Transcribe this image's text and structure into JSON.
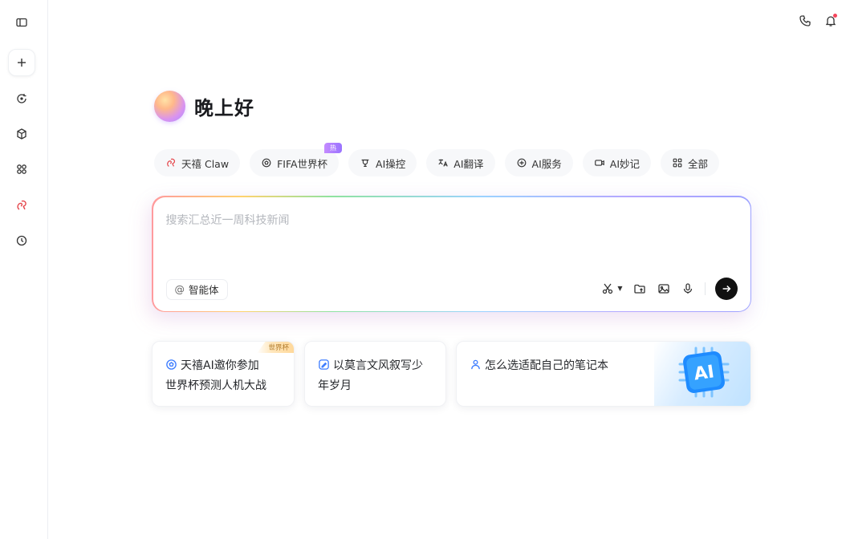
{
  "sidebar": {
    "items": [
      {
        "icon": "sidebar-toggle-icon"
      },
      {
        "icon": "plus-icon"
      },
      {
        "icon": "chat-refresh-icon"
      },
      {
        "icon": "cube-icon"
      },
      {
        "icon": "apps-icon"
      },
      {
        "icon": "claw-icon",
        "color": "#e5484d"
      },
      {
        "icon": "history-icon"
      }
    ]
  },
  "topbar": {
    "icons": [
      "phone-icon",
      "bell-icon"
    ],
    "notification_dot_color": "#f5455c"
  },
  "greeting": "晚上好",
  "chips": [
    {
      "label": "天禧 Claw",
      "icon": "claw-icon",
      "icon_color": "#e5484d"
    },
    {
      "label": "FIFA世界杯",
      "icon": "soccer-icon",
      "badge": "热"
    },
    {
      "label": "AI操控",
      "icon": "steering-icon"
    },
    {
      "label": "AI翻译",
      "icon": "translate-icon"
    },
    {
      "label": "AI服务",
      "icon": "service-icon"
    },
    {
      "label": "AI妙记",
      "icon": "record-icon"
    },
    {
      "label": "全部",
      "icon": "grid-icon"
    }
  ],
  "input": {
    "placeholder": "搜索汇总近一周科技新闻",
    "agent_label": "智能体",
    "tools": [
      "scissors-icon",
      "folder-upload-icon",
      "image-icon",
      "mic-icon"
    ],
    "send_icon": "arrow-right-icon"
  },
  "suggestions": [
    {
      "line1": "天禧AI邀你参加",
      "line2": "世界杯预测人机大战",
      "tag": "世界杯",
      "icon": "soccer-icon"
    },
    {
      "line1": "以莫言文风叙写少",
      "line2": "年岁月",
      "icon": "pen-icon"
    },
    {
      "line1": "怎么选适配自己的笔记本",
      "line2": "",
      "icon": "person-icon",
      "art": "AI"
    }
  ],
  "colors": {
    "accent_blue": "#3b7bff",
    "brand_red": "#e5484d"
  }
}
